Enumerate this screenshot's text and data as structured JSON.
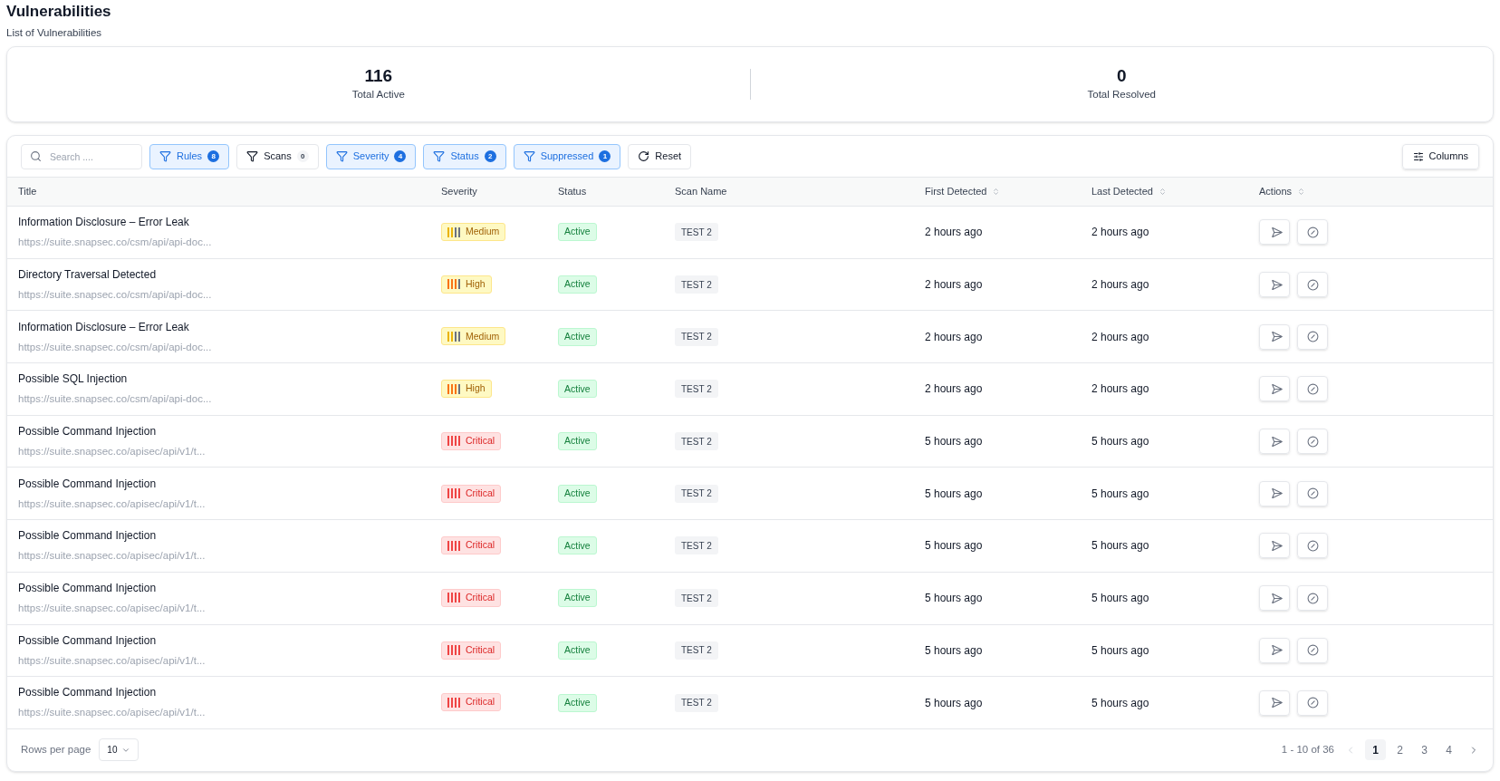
{
  "page": {
    "title": "Vulnerabilities",
    "subtitle": "List of Vulnerabilities"
  },
  "stats": [
    {
      "value": "116",
      "label": "Total Active"
    },
    {
      "value": "0",
      "label": "Total Resolved"
    }
  ],
  "toolbar": {
    "search": {
      "placeholder": "Search ...."
    },
    "filters": [
      {
        "label": "Rules",
        "count": "8",
        "active": true
      },
      {
        "label": "Scans",
        "count": "0",
        "active": false
      },
      {
        "label": "Severity",
        "count": "4",
        "active": true
      },
      {
        "label": "Status",
        "count": "2",
        "active": true
      },
      {
        "label": "Suppressed",
        "count": "1",
        "active": true
      }
    ],
    "reset": "Reset",
    "columns_button": "Columns"
  },
  "table": {
    "columns": [
      {
        "label": "Title",
        "sortable": false
      },
      {
        "label": "Severity",
        "sortable": false
      },
      {
        "label": "Status",
        "sortable": false
      },
      {
        "label": "Scan Name",
        "sortable": false
      },
      {
        "label": "First Detected",
        "sortable": true
      },
      {
        "label": "Last Detected",
        "sortable": true
      },
      {
        "label": "Actions",
        "sortable": true
      }
    ],
    "rows": [
      {
        "title": "Information Disclosure – Error Leak",
        "url": "https://suite.snapsec.co/csm/api/api-doc...",
        "severity": {
          "kind": "medium",
          "label": "Medium"
        },
        "status": "Active",
        "scan": "TEST 2",
        "first": "2 hours ago",
        "last": "2 hours ago"
      },
      {
        "title": "Directory Traversal Detected",
        "url": "https://suite.snapsec.co/csm/api/api-doc...",
        "severity": {
          "kind": "high",
          "label": "High"
        },
        "status": "Active",
        "scan": "TEST 2",
        "first": "2 hours ago",
        "last": "2 hours ago"
      },
      {
        "title": "Information Disclosure – Error Leak",
        "url": "https://suite.snapsec.co/csm/api/api-doc...",
        "severity": {
          "kind": "medium",
          "label": "Medium"
        },
        "status": "Active",
        "scan": "TEST 2",
        "first": "2 hours ago",
        "last": "2 hours ago"
      },
      {
        "title": "Possible SQL Injection",
        "url": "https://suite.snapsec.co/csm/api/api-doc...",
        "severity": {
          "kind": "high",
          "label": "High"
        },
        "status": "Active",
        "scan": "TEST 2",
        "first": "2 hours ago",
        "last": "2 hours ago"
      },
      {
        "title": "Possible Command Injection",
        "url": "https://suite.snapsec.co/apisec/api/v1/t...",
        "severity": {
          "kind": "critical",
          "label": "Critical"
        },
        "status": "Active",
        "scan": "TEST 2",
        "first": "5 hours ago",
        "last": "5 hours ago"
      },
      {
        "title": "Possible Command Injection",
        "url": "https://suite.snapsec.co/apisec/api/v1/t...",
        "severity": {
          "kind": "critical",
          "label": "Critical"
        },
        "status": "Active",
        "scan": "TEST 2",
        "first": "5 hours ago",
        "last": "5 hours ago"
      },
      {
        "title": "Possible Command Injection",
        "url": "https://suite.snapsec.co/apisec/api/v1/t...",
        "severity": {
          "kind": "critical",
          "label": "Critical"
        },
        "status": "Active",
        "scan": "TEST 2",
        "first": "5 hours ago",
        "last": "5 hours ago"
      },
      {
        "title": "Possible Command Injection",
        "url": "https://suite.snapsec.co/apisec/api/v1/t...",
        "severity": {
          "kind": "critical",
          "label": "Critical"
        },
        "status": "Active",
        "scan": "TEST 2",
        "first": "5 hours ago",
        "last": "5 hours ago"
      },
      {
        "title": "Possible Command Injection",
        "url": "https://suite.snapsec.co/apisec/api/v1/t...",
        "severity": {
          "kind": "critical",
          "label": "Critical"
        },
        "status": "Active",
        "scan": "TEST 2",
        "first": "5 hours ago",
        "last": "5 hours ago"
      },
      {
        "title": "Possible Command Injection",
        "url": "https://suite.snapsec.co/apisec/api/v1/t...",
        "severity": {
          "kind": "critical",
          "label": "Critical"
        },
        "status": "Active",
        "scan": "TEST 2",
        "first": "5 hours ago",
        "last": "5 hours ago"
      }
    ]
  },
  "footer": {
    "rows_per_page_label": "Rows per page",
    "rows_per_page": "10",
    "range": "1 - 10 of 36",
    "pages": [
      {
        "label": "1",
        "selected": true
      },
      {
        "label": "2",
        "selected": false
      },
      {
        "label": "3",
        "selected": false
      },
      {
        "label": "4",
        "selected": false
      }
    ]
  }
}
